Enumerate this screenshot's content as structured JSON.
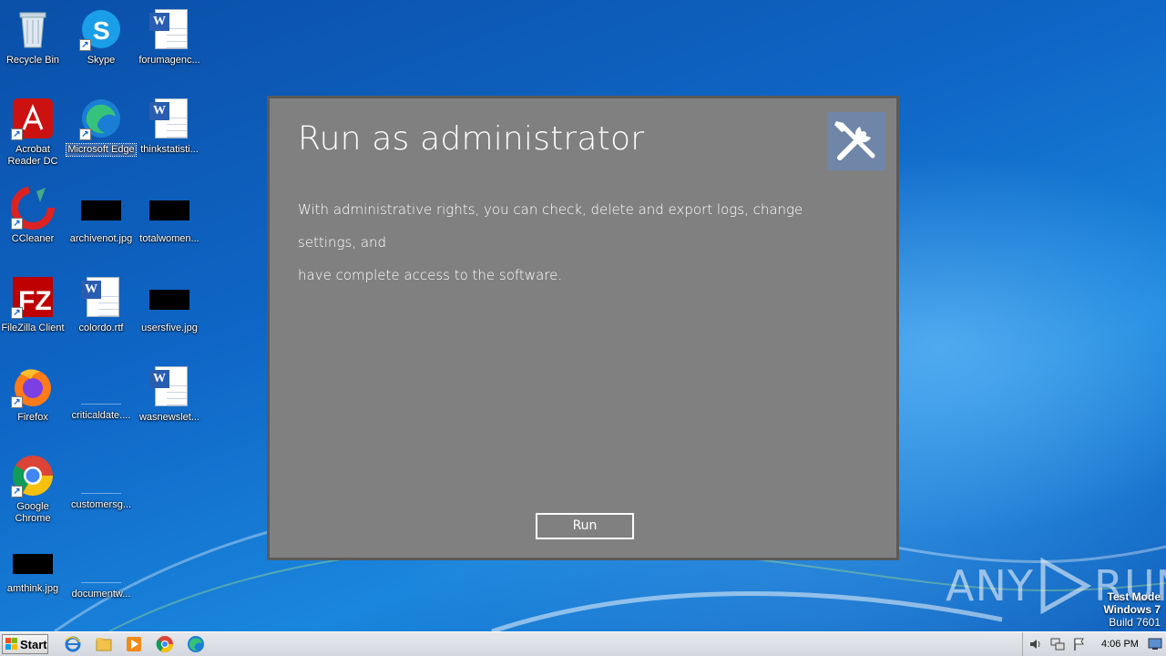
{
  "desktop": {
    "icons": [
      {
        "label": "Recycle Bin",
        "icon": "recycle-bin-icon"
      },
      {
        "label": "Skype",
        "icon": "skype-icon"
      },
      {
        "label": "forumagenc...",
        "icon": "word-document-icon"
      },
      {
        "label": "Acrobat Reader DC",
        "icon": "acrobat-reader-icon"
      },
      {
        "label": "Microsoft Edge",
        "icon": "edge-icon"
      },
      {
        "label": "thinkstatisti...",
        "icon": "word-document-icon"
      },
      {
        "label": "CCleaner",
        "icon": "ccleaner-icon"
      },
      {
        "label": "archivenot.jpg",
        "icon": "image-file-icon"
      },
      {
        "label": "totalwomen...",
        "icon": "image-file-icon"
      },
      {
        "label": "FileZilla Client",
        "icon": "filezilla-icon"
      },
      {
        "label": "colordo.rtf",
        "icon": "word-document-icon"
      },
      {
        "label": "usersfive.jpg",
        "icon": "image-file-icon"
      },
      {
        "label": "Firefox",
        "icon": "firefox-icon"
      },
      {
        "label": "criticaldate....",
        "icon": "blank-file-icon"
      },
      {
        "label": "wasnewslet...",
        "icon": "word-document-icon"
      },
      {
        "label": "Google Chrome",
        "icon": "chrome-icon"
      },
      {
        "label": "customersg...",
        "icon": "blank-file-icon"
      },
      {
        "label": "amthink.jpg",
        "icon": "image-file-icon"
      },
      {
        "label": "documentw...",
        "icon": "blank-file-icon"
      }
    ]
  },
  "dialog": {
    "title": "Run as administrator",
    "body_line1": "With administrative rights, you can check, delete and export logs, change settings, and",
    "body_line2": "have complete access to the software.",
    "run_label": "Run",
    "tool_icon": "tools-icon"
  },
  "watermark": {
    "logo_left": "ANY",
    "logo_right": "RUN",
    "test_mode": "Test Mode",
    "os": "Windows 7",
    "build": "Build 7601"
  },
  "taskbar": {
    "start_label": "Start",
    "clock": "4:06 PM",
    "pinned": [
      "internet-explorer-icon",
      "explorer-icon",
      "media-player-icon",
      "chrome-icon",
      "edge-icon"
    ]
  },
  "colors": {
    "dialog_bg": "#808080",
    "tool_tile": "#6f86a8",
    "desktop_blue": "#0f66c6"
  }
}
